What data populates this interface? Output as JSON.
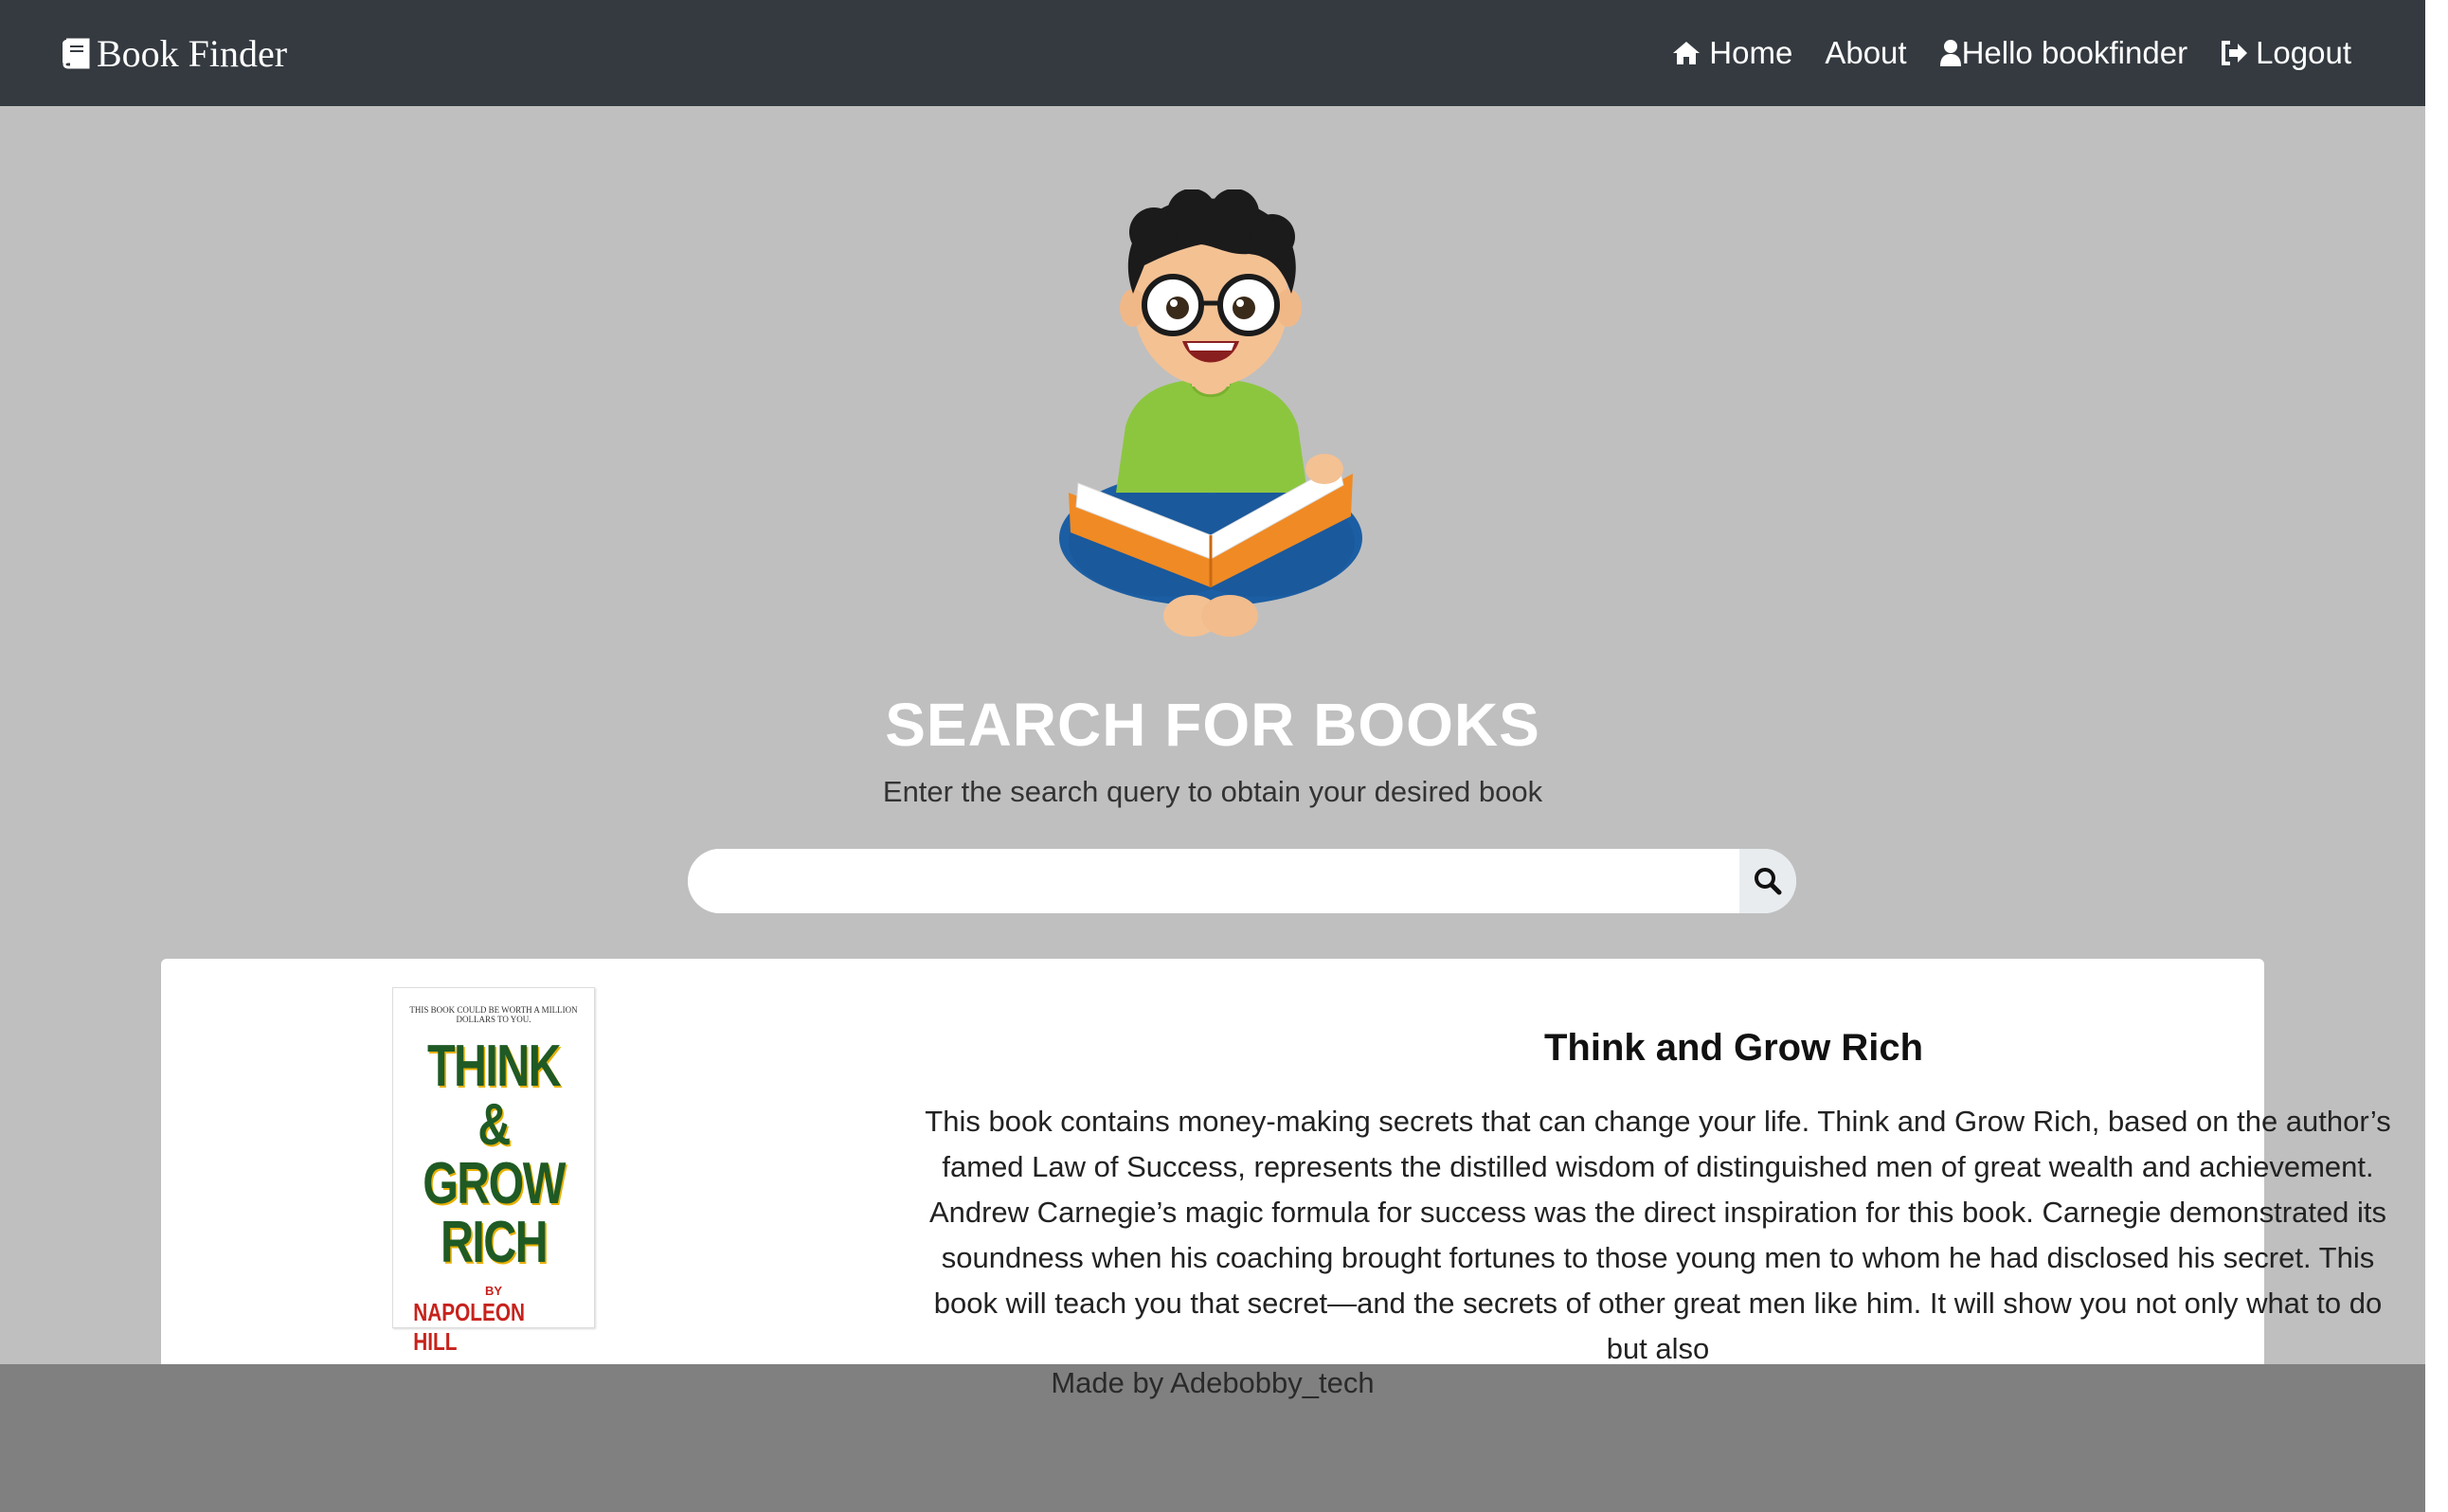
{
  "navbar": {
    "brand": "Book Finder",
    "brand_icon": "book-icon",
    "links": [
      {
        "label": "Home",
        "icon": "home-icon"
      },
      {
        "label": "About"
      },
      {
        "label": "Hello bookfinder",
        "icon": "user-icon"
      },
      {
        "label": "Logout",
        "icon": "sign-out-icon"
      }
    ]
  },
  "hero": {
    "title": "SEARCH FOR BOOKS",
    "subtitle": "Enter the search query to obtain your desired book",
    "illustration": "boy-reading-book-illustration"
  },
  "search": {
    "value": "",
    "placeholder": "",
    "button_icon": "search-icon"
  },
  "result": {
    "title": "Think and Grow Rich",
    "cover": {
      "top_text": "THIS BOOK COULD BE WORTH A MILLION DOLLARS TO YOU.",
      "title_lines": [
        "THINK",
        "& GROW",
        "RICH"
      ],
      "by": "BY",
      "author": "NAPOLEON HILL"
    },
    "description": "This book contains money-making secrets that can change your life. Think and Grow Rich, based on the author’s famed Law of Success, represents the distilled wisdom of distinguished men of great wealth and achievement. Andrew Carnegie’s magic formula for success was the direct inspiration for this book. Carnegie demonstrated its soundness when his coaching brought fortunes to those young men to whom he had disclosed his secret. This book will teach you that secret—and the secrets of other great men like him. It will show you not only what to do but also"
  },
  "footer": {
    "text": "Made by Adebobby_tech"
  },
  "colors": {
    "navbar": "#343a40",
    "page_bg": "#bfbfbf",
    "footer_bg": "#808080",
    "card_bg": "#ffffff"
  }
}
